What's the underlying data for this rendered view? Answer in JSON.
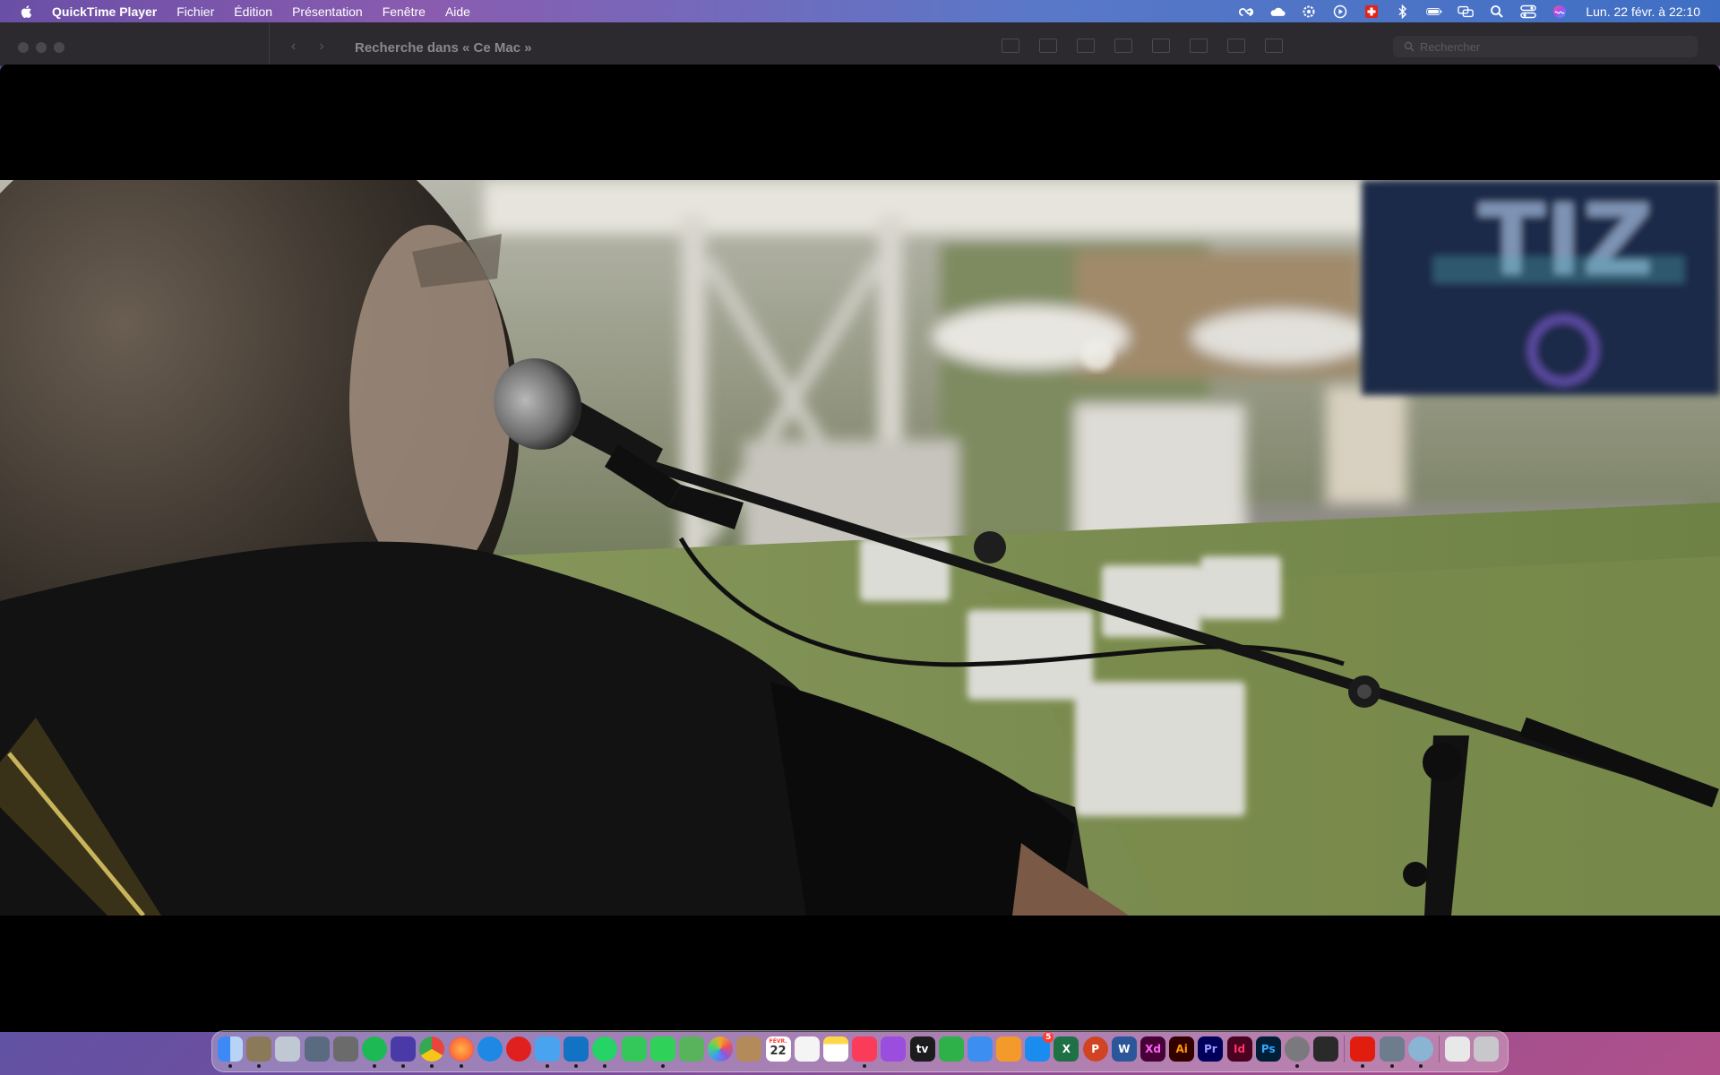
{
  "menubar": {
    "app_name": "QuickTime Player",
    "menus": [
      "Fichier",
      "Édition",
      "Présentation",
      "Fenêtre",
      "Aide"
    ],
    "clock": "Lun. 22 févr. à 22:10",
    "status_icons": [
      "creative-cloud-icon",
      "cloud-icon",
      "settings-gear-icon",
      "play-circle-icon",
      "swiss-flag-icon",
      "bluetooth-icon",
      "battery-icon",
      "screen-mirror-icon",
      "search-icon",
      "control-center-icon",
      "siri-icon"
    ]
  },
  "finder": {
    "title": "Recherche dans « Ce Mac »",
    "search_placeholder": "Rechercher"
  },
  "player": {
    "video": {
      "screen_text": "TIZ"
    }
  },
  "dock": {
    "apps": [
      {
        "name": "finder-icon",
        "color": "#3d8af7"
      },
      {
        "name": "preview-icon",
        "color": "#8a7a5a"
      },
      {
        "name": "launchpad-icon",
        "color": "#c0c8d4"
      },
      {
        "name": "airdrop-icon",
        "color": "#5a6a80"
      },
      {
        "name": "calculator-icon",
        "color": "#6b6b6b"
      },
      {
        "name": "spotify-icon",
        "color": "#1db954"
      },
      {
        "name": "cloud-app-icon",
        "color": "#4a3aa8"
      },
      {
        "name": "chrome-icon",
        "color": "#e8453c"
      },
      {
        "name": "firefox-icon",
        "color": "#ff7139"
      },
      {
        "name": "safari-icon",
        "color": "#1e88e5"
      },
      {
        "name": "opera-icon",
        "color": "#e0201f"
      },
      {
        "name": "mail-icon",
        "color": "#4aa3ee"
      },
      {
        "name": "outlook-icon",
        "color": "#1273c4"
      },
      {
        "name": "whatsapp-icon",
        "color": "#25d366"
      },
      {
        "name": "facetime-icon",
        "color": "#34c759"
      },
      {
        "name": "messages-icon",
        "color": "#30d158"
      },
      {
        "name": "maps-icon",
        "color": "#58b45c"
      },
      {
        "name": "photos-icon",
        "color": "#f5a623"
      },
      {
        "name": "notes-app-icon",
        "color": "#b38a5a"
      },
      {
        "name": "calendar-icon",
        "color": "#ffffff"
      },
      {
        "name": "reminders-icon",
        "color": "#f4f4f4"
      },
      {
        "name": "notes-icon",
        "color": "#ffd84a"
      },
      {
        "name": "music-icon",
        "color": "#fa3c5a"
      },
      {
        "name": "podcasts-icon",
        "color": "#9b4ede"
      },
      {
        "name": "apple-tv-icon",
        "color": "#1c1c1e"
      },
      {
        "name": "numbers-icon",
        "color": "#2fb14a"
      },
      {
        "name": "keynote-icon",
        "color": "#3c8ef0"
      },
      {
        "name": "pages-icon",
        "color": "#f49a2a"
      },
      {
        "name": "app-store-icon",
        "color": "#1a8cf0"
      },
      {
        "name": "excel-icon",
        "color": "#1e7145"
      },
      {
        "name": "powerpoint-icon",
        "color": "#d04423"
      },
      {
        "name": "word-icon",
        "color": "#2b579a"
      },
      {
        "name": "adobe-xd-icon",
        "color": "#470137"
      },
      {
        "name": "illustrator-icon",
        "color": "#330000"
      },
      {
        "name": "premiere-icon",
        "color": "#00005b"
      },
      {
        "name": "indesign-icon",
        "color": "#49021f"
      },
      {
        "name": "photoshop-icon",
        "color": "#001e36"
      },
      {
        "name": "system-preferences-icon",
        "color": "#7a7a7e"
      },
      {
        "name": "terminal-icon",
        "color": "#2a2a2a"
      }
    ],
    "apps_right": [
      {
        "name": "acrobat-icon",
        "color": "#e11d0f"
      },
      {
        "name": "screenshot-icon",
        "color": "#6d7d8d"
      },
      {
        "name": "quicktime-icon",
        "color": "#8ab4d4"
      }
    ],
    "stacks": [
      {
        "name": "downloads-stack-icon",
        "color": "#e8e8e8"
      },
      {
        "name": "trash-icon",
        "color": "#c8c8cc"
      }
    ],
    "labels": {
      "apple_tv": "tv",
      "excel": "X",
      "powerpoint": "P",
      "word": "W",
      "xd": "Xd",
      "illustrator": "Ai",
      "premiere": "Pr",
      "indesign": "Id",
      "photoshop": "Ps",
      "calendar_month": "FÉVR.",
      "calendar_day": "22",
      "app_store_badge": "5"
    }
  }
}
